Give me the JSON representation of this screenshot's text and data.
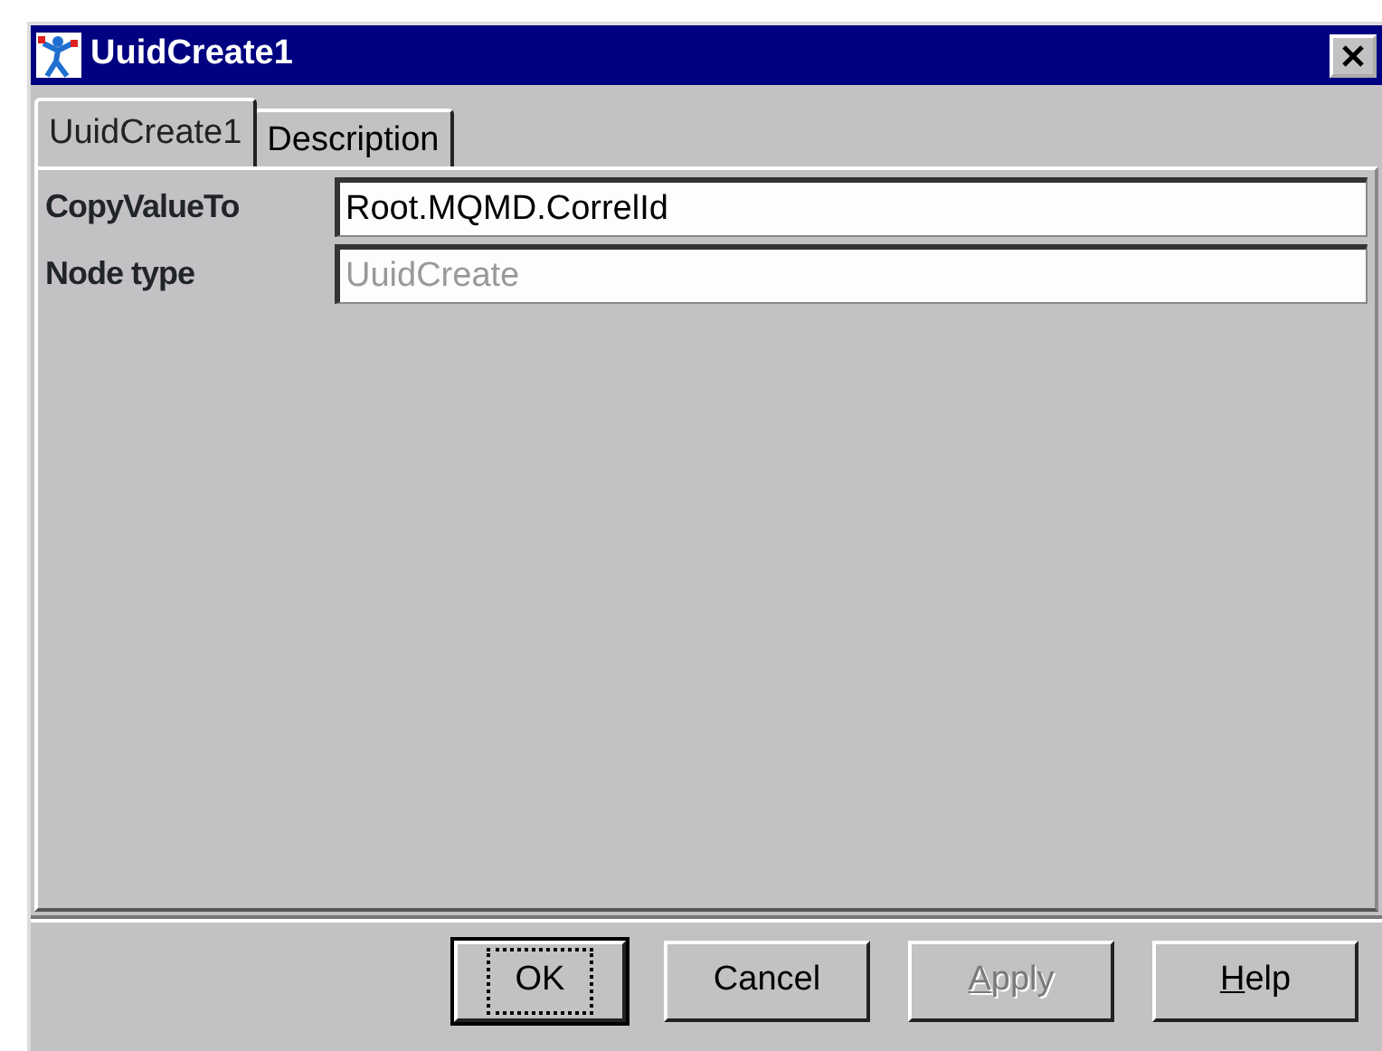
{
  "window": {
    "title": "UuidCreate1"
  },
  "tabs": [
    {
      "label": "UuidCreate1",
      "selected": true
    },
    {
      "label": "Description",
      "selected": false
    }
  ],
  "properties": [
    {
      "label": "CopyValueTo",
      "value": "Root.MQMD.CorrelId",
      "disabled": false
    },
    {
      "label": "Node type",
      "value": "UuidCreate",
      "disabled": true
    }
  ],
  "buttons": [
    {
      "label": "OK",
      "default": true,
      "disabled": false,
      "underline_first": false
    },
    {
      "label": "Cancel",
      "default": false,
      "disabled": false,
      "underline_first": false
    },
    {
      "label": "Apply",
      "default": false,
      "disabled": true,
      "underline_first": true
    },
    {
      "label": "Help",
      "default": false,
      "disabled": false,
      "underline_first": true
    }
  ]
}
